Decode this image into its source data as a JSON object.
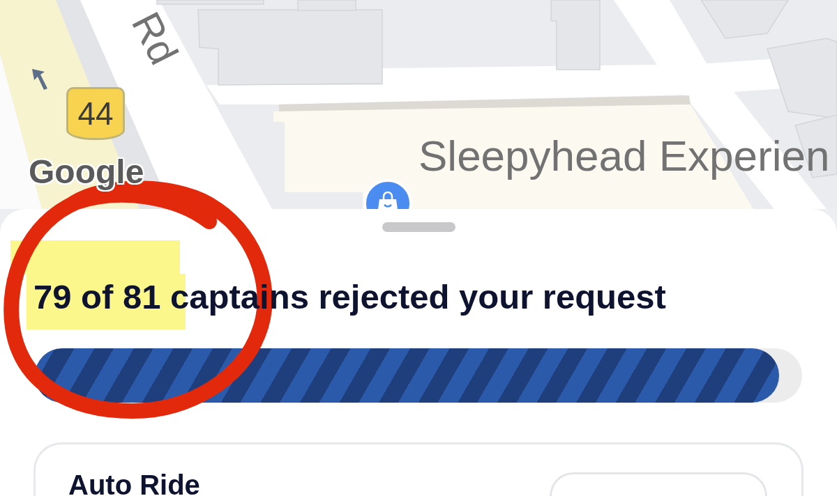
{
  "map": {
    "road_label": "Rd",
    "route_shield": "44",
    "attribution": "Google",
    "place_label": "Sleepyhead Experien"
  },
  "sheet": {
    "headline": "79 of 81 captains rejected your request",
    "progress": {
      "level": 0.97
    }
  },
  "ride_card": {
    "title": "Auto Ride"
  }
}
